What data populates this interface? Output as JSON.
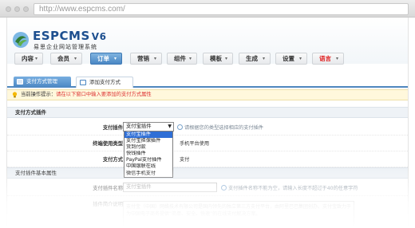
{
  "browser": {
    "url": "http://www.espcms.com/"
  },
  "header": {
    "logo_main": "ESPCMS",
    "logo_version": "V6",
    "logo_subtitle": "易思企业网站管理系统"
  },
  "nav": {
    "items": [
      {
        "label": "内容"
      },
      {
        "label": "会员"
      },
      {
        "label": "订单"
      },
      {
        "label": "营销"
      },
      {
        "label": "组件"
      },
      {
        "label": "模板"
      },
      {
        "label": "生成"
      },
      {
        "label": "设置"
      },
      {
        "label": "语言"
      }
    ],
    "active": "订单"
  },
  "tabs": [
    {
      "label": "支付方式管理"
    },
    {
      "label": "添加支付方式"
    }
  ],
  "tip": {
    "label": "当前操作提示：",
    "text": "请在以下窗口中输入要添加的支付方式属性"
  },
  "sections": {
    "payment_method": "支付方式插件",
    "basic_attrs": "支付插件基本属性"
  },
  "form": {
    "plugin_label": "支付插件",
    "plugin_selected": "支付宝插件",
    "plugin_hint": "请根据您的类型选择相应的支付插件",
    "terminal_label": "终端使用类型",
    "terminal_text": "手机平台使用",
    "method_label": "支付方式",
    "method_text": "支付",
    "name_label": "支付插件名称",
    "name_value": "支付宝插件",
    "name_hint": "支付插件名称不能为空，请输入长度不超过于40的任意字符",
    "desc_label": "插件简介说明",
    "desc_value": "支付宝（中国）网络技术有限公司是国内领先的独立第三方支付平台，由阿里巴巴集团创办。支付宝致力于为中国电子商务提供“简单、安全、快速”的在线支付解决方案。"
  },
  "dropdown_options": [
    "支付宝插件",
    "支付宝担保插件",
    "货到付款",
    "快钱插件",
    "PayPal支付插件",
    "中国银联在线",
    "微信手机支付"
  ],
  "colors": {
    "nav_active": "#4a87c4",
    "tab_active": "#4a86c2",
    "tip_bg": "#fff8dc",
    "tip_text": "#dd3333",
    "lang_label": "#e02020",
    "dropdown_selected": "#2f6fd6",
    "logo": "#1d4f8f"
  }
}
